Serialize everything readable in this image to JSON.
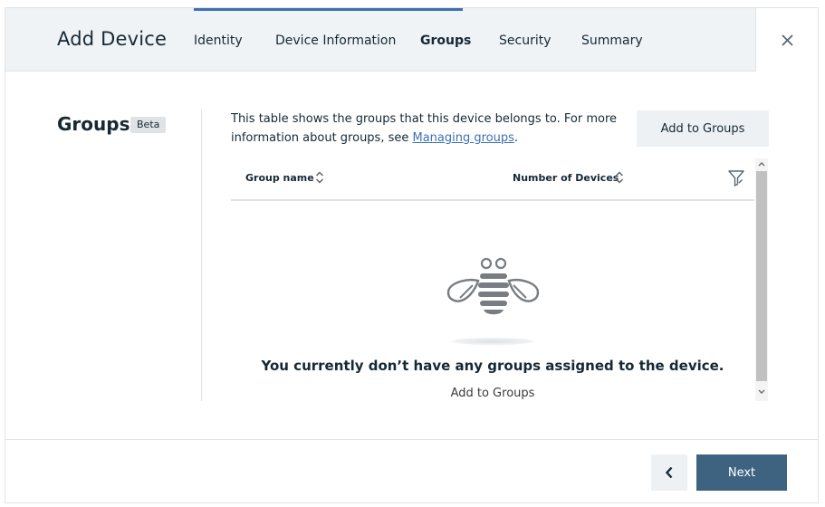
{
  "header": {
    "title": "Add Device",
    "tabs": [
      {
        "label": "Identity"
      },
      {
        "label": "Device Information"
      },
      {
        "label": "Groups",
        "active": true
      },
      {
        "label": "Security"
      },
      {
        "label": "Summary"
      }
    ],
    "close_icon": "close-icon"
  },
  "section": {
    "title": "Groups",
    "badge": "Beta",
    "description_text": "This table shows the groups that this device belongs to. For more information about groups, see ",
    "description_link": "Managing groups",
    "description_end": ".",
    "add_button": "Add to Groups"
  },
  "table": {
    "columns": [
      {
        "label": "Group name",
        "sort_icon": "sort-icon"
      },
      {
        "label": "Number of Devices",
        "sort_icon": "sort-icon"
      }
    ],
    "filter_icon": "filter-icon",
    "rows": [],
    "empty_state": {
      "icon": "bee-icon",
      "title": "You currently don’t have any groups assigned to the device.",
      "link": "Add to Groups"
    }
  },
  "footer": {
    "back_icon": "chevron-left-icon",
    "next_label": "Next"
  },
  "colors": {
    "accent": "#3d70b2",
    "primary_button": "#3d6380",
    "header_bg": "#f0f3f6",
    "secondary_button": "#eef1f4"
  }
}
